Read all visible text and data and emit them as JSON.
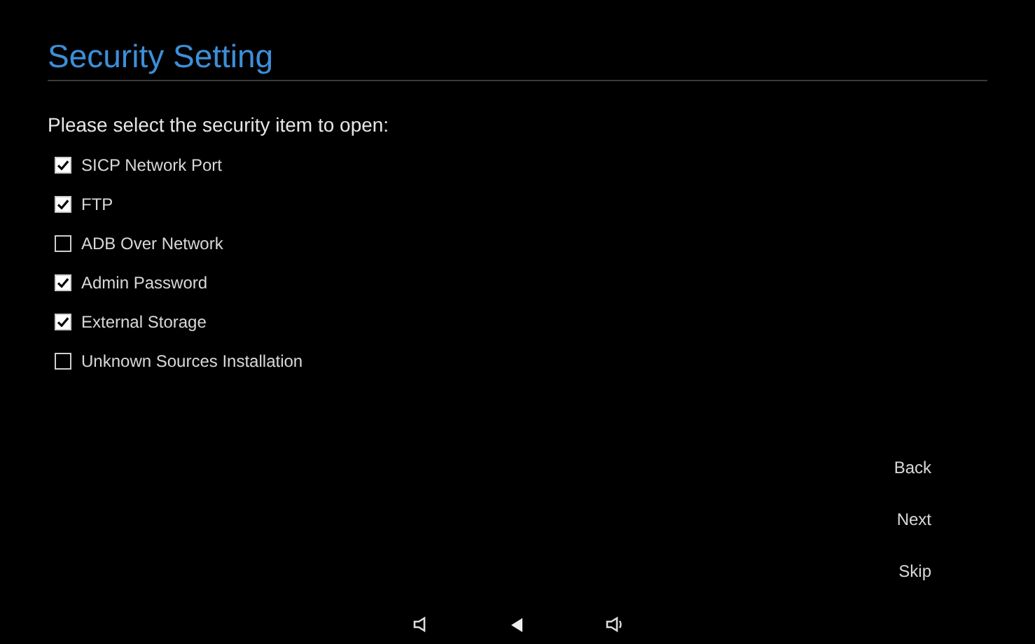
{
  "title": "Security Setting",
  "prompt": "Please select the security item to open:",
  "items": [
    {
      "label": "SICP Network Port",
      "checked": true
    },
    {
      "label": "FTP",
      "checked": true
    },
    {
      "label": "ADB Over Network",
      "checked": false
    },
    {
      "label": "Admin Password",
      "checked": true
    },
    {
      "label": "External Storage",
      "checked": true
    },
    {
      "label": "Unknown Sources Installation",
      "checked": false
    }
  ],
  "buttons": [
    "Back",
    "Next",
    "Skip"
  ]
}
